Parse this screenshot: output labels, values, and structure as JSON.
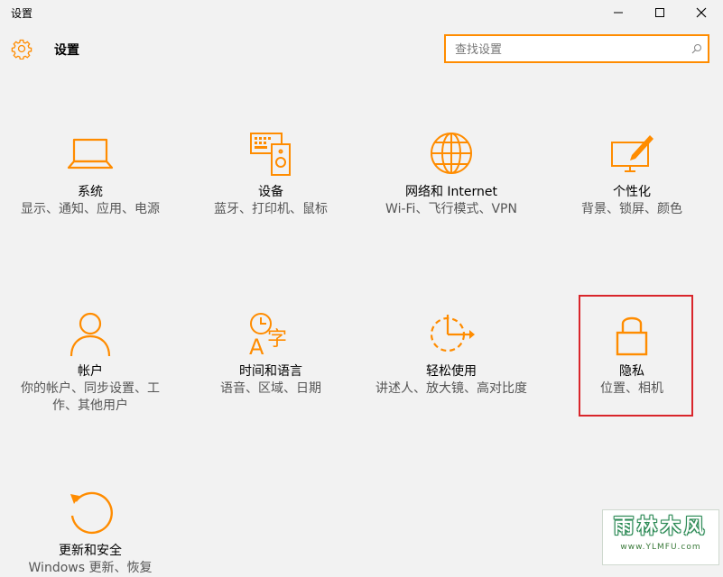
{
  "window": {
    "title": "设置"
  },
  "header": {
    "title": "设置",
    "search": {
      "placeholder": "查找设置",
      "value": ""
    }
  },
  "theme": {
    "accent": "#ff8c00",
    "highlight": "#d9262b"
  },
  "tiles": [
    {
      "icon": "laptop-icon",
      "label": "系统",
      "desc": "显示、通知、应用、电源"
    },
    {
      "icon": "devices-icon",
      "label": "设备",
      "desc": "蓝牙、打印机、鼠标"
    },
    {
      "icon": "globe-icon",
      "label": "网络和 Internet",
      "desc": "Wi-Fi、飞行模式、VPN"
    },
    {
      "icon": "personalize-icon",
      "label": "个性化",
      "desc": "背景、锁屏、颜色"
    },
    {
      "icon": "person-icon",
      "label": "帐户",
      "desc": "你的帐户、同步设置、工作、其他用户"
    },
    {
      "icon": "time-language-icon",
      "label": "时间和语言",
      "desc": "语音、区域、日期"
    },
    {
      "icon": "ease-of-access-icon",
      "label": "轻松使用",
      "desc": "讲述人、放大镜、高对比度"
    },
    {
      "icon": "lock-icon",
      "label": "隐私",
      "desc": "位置、相机"
    },
    {
      "icon": "update-icon",
      "label": "更新和安全",
      "desc": "Windows 更新、恢复"
    }
  ],
  "watermark": {
    "title": "雨林木风",
    "url": "www.YLMFU.com"
  }
}
